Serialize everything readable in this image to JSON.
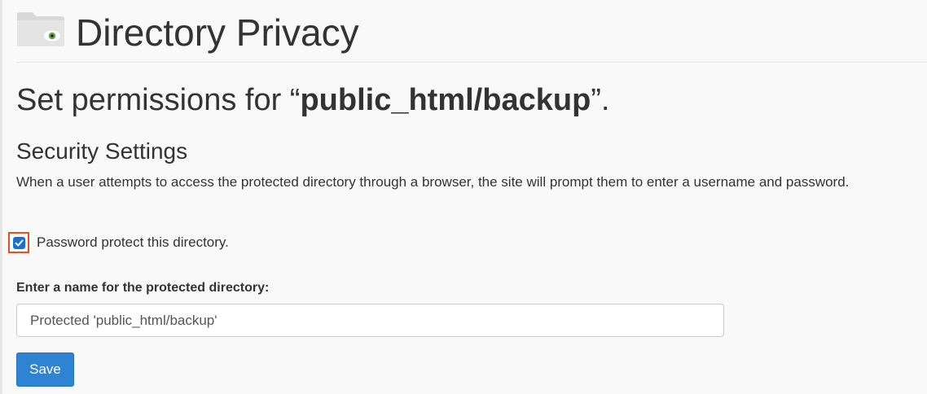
{
  "header": {
    "title": "Directory Privacy",
    "icon": "folder-eye-icon"
  },
  "permissions": {
    "prefix": "Set permissions for “",
    "path": "public_html/backup",
    "suffix": "”."
  },
  "security": {
    "title": "Security Settings",
    "description": "When a user attempts to access the protected directory through a browser, the site will prompt them to enter a username and password."
  },
  "password_protect": {
    "label": "Password protect this directory.",
    "checked": true
  },
  "directory_name": {
    "label": "Enter a name for the protected directory:",
    "value": "Protected 'public_html/backup'"
  },
  "actions": {
    "save_label": "Save"
  },
  "colors": {
    "accent": "#2f83d3",
    "highlight": "#e8501e",
    "checkbox": "#1a6fd4"
  }
}
